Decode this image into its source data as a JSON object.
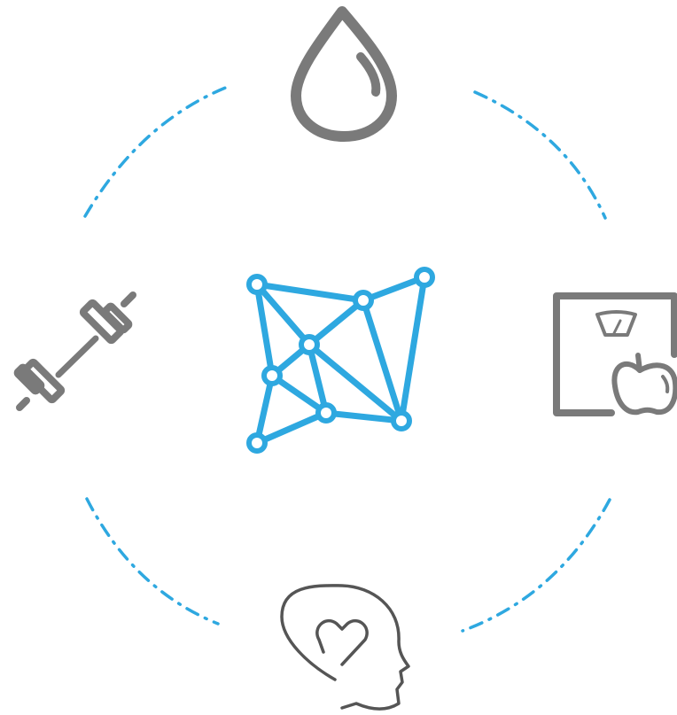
{
  "colors": {
    "accent": "#2ea8e0",
    "icon_gray": "#7a7a7a",
    "outline_dark": "#555555",
    "background": "#ffffff"
  },
  "diagram": {
    "center_icon": "network-graph-icon",
    "orbit_style": "dash-dot",
    "surrounding_icons": [
      "water-drop-icon",
      "scale-with-apple-icon",
      "head-with-heart-icon",
      "dumbbell-icon"
    ]
  }
}
